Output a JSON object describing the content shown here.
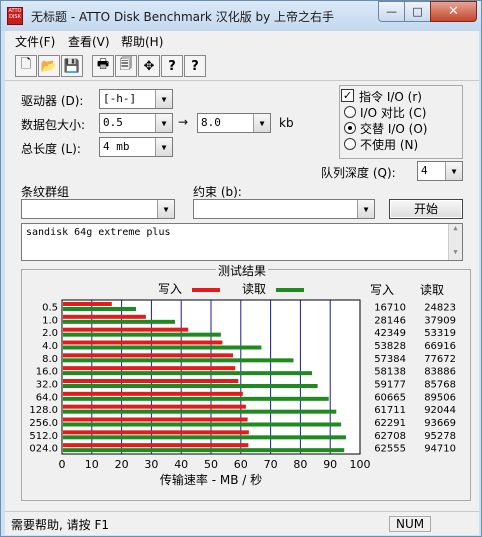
{
  "window": {
    "title": "无标题 - ATTO Disk Benchmark  汉化版 by 上帝之右手",
    "minimize": "—",
    "maximize": "□",
    "close": "✕",
    "icon_text": "ATTO DISK"
  },
  "menu": {
    "items": [
      "文件(F)",
      "查看(V)",
      "帮助(H)"
    ]
  },
  "toolbar": {
    "icons": [
      "new-file-icon",
      "open-folder-icon",
      "save-disk-icon",
      "print-icon",
      "print-preview-icon",
      "move-icon",
      "help-icon",
      "context-help-icon"
    ],
    "glyphs": [
      "🗋",
      "📂",
      "💾",
      "🖶",
      "🗐",
      "✥",
      "?",
      "?"
    ]
  },
  "settings": {
    "drive_label": "驱动器 (D):",
    "drive_value": "[-h-]",
    "transfer_label": "数据包大小:",
    "transfer_from": "0.5",
    "transfer_arrow": "→",
    "transfer_to": "8.0",
    "transfer_unit": "kb",
    "length_label": "总长度 (L):",
    "length_value": "4 mb",
    "direct_io_label": "指令 I/O (r)",
    "direct_io_checked": "✓",
    "io_compare_label": "I/O 对比 (C)",
    "overlapped_io_label": "交替 I/O (O)",
    "neither_label": "不使用 (N)",
    "queue_label": "队列深度 (Q):",
    "queue_value": "4",
    "stripe_label": "条纹群组",
    "constraint_label": "约束 (b):",
    "start_button": "开始",
    "description": "sandisk 64g extreme plus"
  },
  "results": {
    "title": "测试结果",
    "write_label": "写入",
    "read_label": "读取",
    "write_col": "写入",
    "read_col": "读取",
    "write_color": "#e41b1b",
    "read_color": "#1f8a1f",
    "axis_title": "传输速率 - MB / 秒"
  },
  "chart_data": {
    "type": "bar",
    "orientation": "horizontal",
    "categories": [
      "0.5",
      "1.0",
      "2.0",
      "4.0",
      "8.0",
      "16.0",
      "32.0",
      "64.0",
      "128.0",
      "256.0",
      "512.0",
      "024.0"
    ],
    "series": [
      {
        "name": "写入",
        "values": [
          16710,
          28146,
          42349,
          53828,
          57384,
          58138,
          59177,
          60665,
          61711,
          62291,
          62708,
          62555
        ]
      },
      {
        "name": "读取",
        "values": [
          24823,
          37909,
          53319,
          66916,
          77672,
          83886,
          85768,
          89506,
          92044,
          93669,
          95278,
          94710
        ]
      }
    ],
    "xticks": [
      "0",
      "10",
      "20",
      "30",
      "40",
      "50",
      "60",
      "70",
      "80",
      "90",
      "100"
    ],
    "xlim": [
      0,
      100
    ],
    "xlabel": "传输速率 - MB / 秒",
    "grid": true,
    "legend_position": "top"
  },
  "status": {
    "help": "需要帮助, 请按 F1",
    "num": "NUM"
  }
}
